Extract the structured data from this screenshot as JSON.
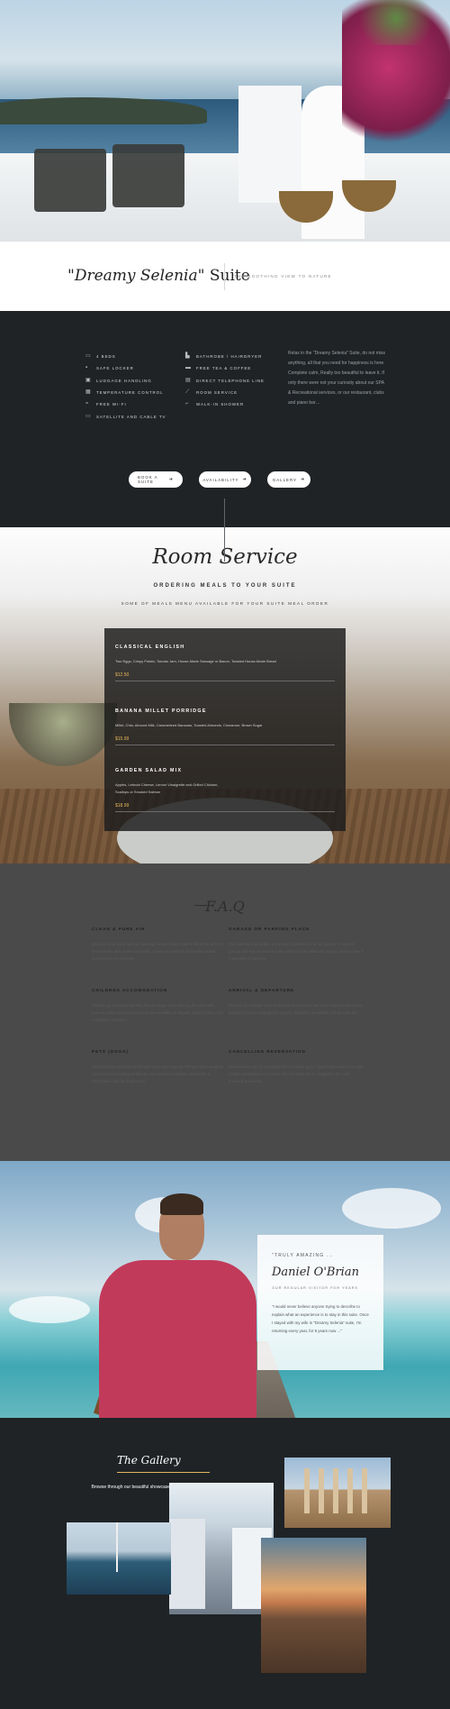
{
  "hero": {
    "suite_name_quoted": "\"Dreamy Selenia\"",
    "suite_word": " Suite",
    "tagline": "THE SOOTHING VIEW TO NATURE"
  },
  "amenities": {
    "col1": [
      {
        "icon": "bed-icon",
        "label": "4 BEDS",
        "glyph": "▭"
      },
      {
        "icon": "lock-icon",
        "label": "SAFE LOCKER",
        "glyph": "▪"
      },
      {
        "icon": "luggage-icon",
        "label": "LUGGAGE HANDLING",
        "glyph": "▣"
      },
      {
        "icon": "thermometer-icon",
        "label": "TEMPERATURE CONTROL",
        "glyph": "▦"
      },
      {
        "icon": "wifi-icon",
        "label": "FREE WI-FI",
        "glyph": "≈"
      },
      {
        "icon": "tv-icon",
        "label": "SATELLITE AND CABLE TV",
        "glyph": "▭"
      }
    ],
    "col2": [
      {
        "icon": "bathrobe-icon",
        "label": "BATHROBE / HAIRDRYER",
        "glyph": "▙"
      },
      {
        "icon": "coffee-icon",
        "label": "FREE TEA & COFFEE",
        "glyph": "▬"
      },
      {
        "icon": "phone-icon",
        "label": "DIRECT TELEPHONE LINE",
        "glyph": "▤"
      },
      {
        "icon": "room-service-icon",
        "label": "ROOM SERVICE",
        "glyph": "⟋"
      },
      {
        "icon": "shower-icon",
        "label": "WALK-IN SHOWER",
        "glyph": "⌐"
      }
    ],
    "about": "Relax in the \"Dreamy Selenia\" Suite, do not miss anything, all that you need for happiness is here. Complete calm, Really too beautiful to leave it. If only there were not your curiosity about our SPA & Recreational services, or our restaurant, clubs and piano bar…",
    "buttons": [
      {
        "label": "BOOK A SUITE",
        "arrow": "➜"
      },
      {
        "label": "AVAILABILITY",
        "arrow": "➜"
      },
      {
        "label": "GALLERY",
        "arrow": "➜"
      }
    ]
  },
  "room_service": {
    "title": "Room Service",
    "subtitle": "ORDERING MEALS TO YOUR SUITE",
    "subtitle2": "SOME OF MEALS MENU AVAILABLE FOR YOUR SUITE MEAL ORDER",
    "items": [
      {
        "name": "CLASSICAL ENGLISH",
        "desc": "Two Eggs, Crispy Potato, Tomato Jam, House-Made Sausage or Bacon, Toasted House-Made Bread",
        "price": "$12.50"
      },
      {
        "name": "BANANA MILLET PORRIDGE",
        "desc": "Millet, Chia, Almond Milk, Caramelized Bananas, Toasted Almonds, Cinnamon, Brown Sugar",
        "price": "$15.99"
      },
      {
        "name": "GARDEN SALAD MIX",
        "desc": "Apples, Lebnah Cheese, Lemon Vinaigrette and Grilled Chicken, Scallops or Smoked Salmon",
        "price": "$18.99"
      }
    ]
  },
  "faq": {
    "title": "F.A.Q",
    "items": [
      {
        "q": "CLEAN & PURE AIR",
        "a": "Our suite and rooms with air cleaning. Air purification system filters the air from fine particles dust, pollen and mold, creating a healthier and fresher indoor environment for everyone."
      },
      {
        "q": "GARAGE OR PARKING PLACE",
        "a": "Free parking is available on the hotel premises for all our guests. A covered garage with secure access is also offered at an additional charge; please make a reservation in advance."
      },
      {
        "q": "CHILDREN ACCOMODATION",
        "a": "Children up to 5 years old stay free of charge when sharing the suite with parents. Baby cots and extra beds are available on request; please contact our reception in advance."
      },
      {
        "q": "ARRIVAL & DEPARTURE",
        "a": "Check-in is available from 14:00 and check-out is until 12:00. Early arrival or late departure can be arranged on request, subject to availability and an extra fee."
      },
      {
        "q": "PETS (DOGS)",
        "a": "Small pets are welcome in the suite upon prior request. Please inform us about your pet when booking so that we can prepare everything needed for a comfortable stay for both of you."
      },
      {
        "q": "CANCELLING RESERVATION",
        "a": "Reservations can be cancelled free of charge up to 7 days before arrival. In case of later cancellation or no-show, the first night will be charged to the card provided at booking."
      }
    ]
  },
  "testimonial": {
    "kicker": "\"TRULY AMAZING ...",
    "name": "Daniel O'Brian",
    "role": "OUR REGULAR VISITOR FOR YEARS",
    "quote": "\"I would never believe anyone trying to describe to explain what an experience is to stay in this suite. Once I stayed with my wife in \"Dreamy Selenia\" suite, I'm returning every year, for 8 years now ...\""
  },
  "gallery": {
    "title": "The Gallery",
    "desc": "Browse through our beautiful showcase of sights around town."
  }
}
